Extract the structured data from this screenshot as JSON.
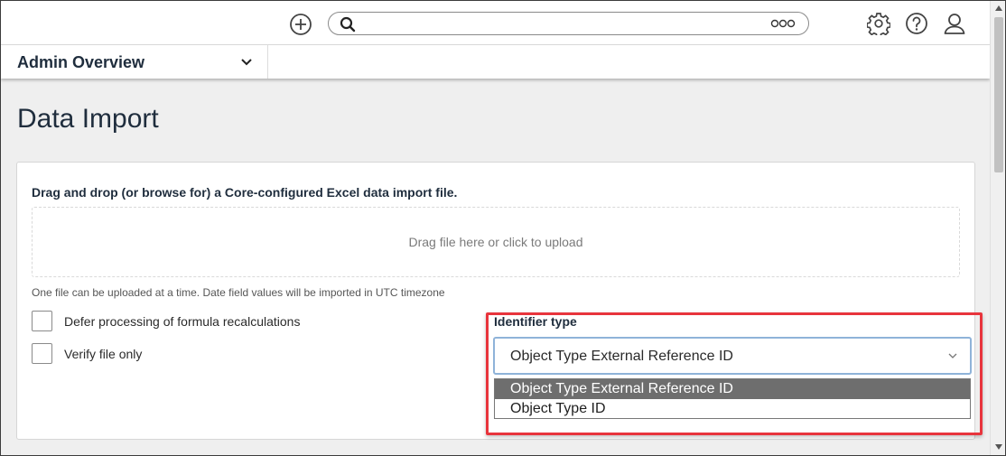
{
  "header": {
    "search": {
      "value": "",
      "placeholder": ""
    },
    "icons": [
      "add-icon",
      "search-icon",
      "more-icon",
      "gear-icon",
      "help-icon",
      "user-icon"
    ]
  },
  "nav": {
    "overview_label": "Admin Overview"
  },
  "page": {
    "title": "Data Import"
  },
  "import": {
    "heading": "Drag and drop (or browse for) a Core-configured Excel data import file.",
    "dropzone_text": "Drag file here or click to upload",
    "hint": "One file can be uploaded at a time. Date field values will be imported in UTC timezone",
    "options": [
      {
        "label": "Defer processing of formula recalculations",
        "checked": false
      },
      {
        "label": "Verify file only",
        "checked": false
      }
    ]
  },
  "identifier": {
    "label": "Identifier type",
    "selected": "Object Type External Reference ID",
    "choices": [
      "Object Type External Reference ID",
      "Object Type ID"
    ],
    "highlighted_index": 0
  },
  "colors": {
    "highlight_border": "#e8343c",
    "focus_border": "#8fb3d9",
    "option_highlight": "#6e6e6e",
    "page_background": "#efefef"
  }
}
